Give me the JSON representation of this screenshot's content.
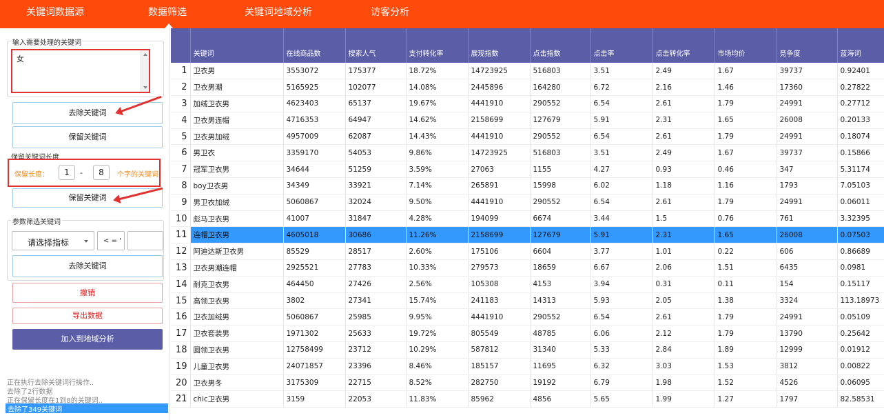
{
  "nav": {
    "tabs": [
      "关键词数据源",
      "数据筛选",
      "关键词地域分析",
      "访客分析"
    ],
    "active_tab": "数据筛选"
  },
  "left": {
    "keyword_section_title": "输入需要处理的关键词",
    "keyword_input_value": "女",
    "remove_keyword_button": "去除关键词",
    "keep_keyword_button": "保留关键词",
    "length_section_title": "保留关键词长度",
    "length_label": "保留长度：",
    "length_min": "1",
    "length_dash": "-",
    "length_max": "8",
    "length_suffix": "个字的关键词",
    "keep_by_length_button": "保留关键词",
    "param_section_title": "参数筛选关键词",
    "metric_select": "请选择指标",
    "operator_select": "< = '",
    "param_value": "",
    "param_remove_button": "去除关键词",
    "undo_button": "撤销",
    "export_button": "导出数据",
    "add_region_button": "加入到地域分析",
    "log": [
      "正在执行去除关键词行操作..",
      "去除了2行数据",
      "正在保留长度在1到8的关键词..",
      "去除了349关键词"
    ]
  },
  "table": {
    "columns": [
      "关键词",
      "在线商品数",
      "搜索人气",
      "支付转化率",
      "展现指数",
      "点击指数",
      "点击率",
      "点击转化率",
      "市场均价",
      "竞争度",
      "蓝海词"
    ],
    "selected_row": 11,
    "rows": [
      {
        "idx": "1",
        "cells": [
          "卫衣男",
          "3553072",
          "175377",
          "18.72%",
          "14723925",
          "516803",
          "3.51",
          "2.49",
          "1.67",
          "39737",
          "0.92401"
        ]
      },
      {
        "idx": "2",
        "cells": [
          "卫衣男潮",
          "5165925",
          "102077",
          "14.08%",
          "2445896",
          "164280",
          "6.72",
          "2.16",
          "1.46",
          "17360",
          "0.27822"
        ]
      },
      {
        "idx": "3",
        "cells": [
          "加绒卫衣男",
          "4623403",
          "65137",
          "19.67%",
          "4441910",
          "290552",
          "6.54",
          "2.61",
          "1.79",
          "24991",
          "0.27712"
        ]
      },
      {
        "idx": "4",
        "cells": [
          "卫衣男连帽",
          "4716353",
          "64947",
          "14.62%",
          "2158699",
          "127679",
          "5.91",
          "2.31",
          "1.65",
          "26008",
          "0.20133"
        ]
      },
      {
        "idx": "5",
        "cells": [
          "卫衣男加绒",
          "4957009",
          "62087",
          "14.43%",
          "4441910",
          "290552",
          "6.54",
          "2.61",
          "1.79",
          "24991",
          "0.18074"
        ]
      },
      {
        "idx": "6",
        "cells": [
          "男卫衣",
          "3359170",
          "54053",
          "9.86%",
          "14723925",
          "516803",
          "3.51",
          "2.49",
          "1.67",
          "39737",
          "0.15866"
        ]
      },
      {
        "idx": "7",
        "cells": [
          "冠军卫衣男",
          "34644",
          "51259",
          "3.59%",
          "27063",
          "1155",
          "4.27",
          "0.93",
          "0.46",
          "347",
          "5.31174"
        ]
      },
      {
        "idx": "8",
        "cells": [
          "boy卫衣男",
          "34349",
          "33921",
          "7.14%",
          "265891",
          "15998",
          "6.02",
          "1.18",
          "1.16",
          "1793",
          "7.05103"
        ]
      },
      {
        "idx": "9",
        "cells": [
          "男卫衣加绒",
          "5060867",
          "32024",
          "9.50%",
          "4441910",
          "290552",
          "6.54",
          "2.61",
          "1.79",
          "24991",
          "0.06011"
        ]
      },
      {
        "idx": "10",
        "cells": [
          "彪马卫衣男",
          "41007",
          "31847",
          "4.28%",
          "194099",
          "6674",
          "3.44",
          "1.5",
          "0.76",
          "761",
          "3.32395"
        ]
      },
      {
        "idx": "11",
        "cells": [
          "连帽卫衣男",
          "4605018",
          "30686",
          "11.26%",
          "2158699",
          "127679",
          "5.91",
          "2.31",
          "1.65",
          "26008",
          "0.07503"
        ]
      },
      {
        "idx": "12",
        "cells": [
          "阿迪达斯卫衣男",
          "85529",
          "28517",
          "2.60%",
          "175106",
          "6604",
          "3.77",
          "1.01",
          "0.22",
          "606",
          "0.86689"
        ]
      },
      {
        "idx": "13",
        "cells": [
          "卫衣男潮连帽",
          "2925521",
          "27783",
          "10.33%",
          "279573",
          "18659",
          "6.67",
          "2.06",
          "1.51",
          "6435",
          "0.0981"
        ]
      },
      {
        "idx": "14",
        "cells": [
          "耐克卫衣男",
          "464450",
          "27426",
          "2.56%",
          "105308",
          "4153",
          "3.94",
          "0.31",
          "0.11",
          "154",
          "0.15117"
        ]
      },
      {
        "idx": "15",
        "cells": [
          "高领卫衣男",
          "3802",
          "27341",
          "15.74%",
          "241183",
          "14313",
          "5.93",
          "2.05",
          "1.38",
          "3324",
          "113.18973"
        ]
      },
      {
        "idx": "16",
        "cells": [
          "卫衣加绒男",
          "5060867",
          "25985",
          "9.95%",
          "4441910",
          "290552",
          "6.54",
          "2.61",
          "1.79",
          "24991",
          "0.05109"
        ]
      },
      {
        "idx": "17",
        "cells": [
          "卫衣套装男",
          "1971302",
          "25633",
          "19.72%",
          "805549",
          "48785",
          "6.06",
          "2.12",
          "1.79",
          "13790",
          "0.25642"
        ]
      },
      {
        "idx": "18",
        "cells": [
          "圆领卫衣男",
          "12758499",
          "23712",
          "10.29%",
          "587812",
          "31340",
          "5.33",
          "2.84",
          "1.89",
          "12999",
          "0.01912"
        ]
      },
      {
        "idx": "19",
        "cells": [
          "儿童卫衣男",
          "24071857",
          "23396",
          "8.46%",
          "185157",
          "11695",
          "6.32",
          "3.03",
          "1.53",
          "3812",
          "0.00822"
        ]
      },
      {
        "idx": "20",
        "cells": [
          "卫衣男冬",
          "3175309",
          "22715",
          "8.52%",
          "282750",
          "19192",
          "6.79",
          "1.98",
          "1.52",
          "4526",
          "0.06095"
        ]
      },
      {
        "idx": "21",
        "cells": [
          "chic卫衣男",
          "3159",
          "22053",
          "11.83%",
          "85962",
          "4856",
          "5.65",
          "1.99",
          "1.27",
          "1797",
          "82.58531"
        ]
      }
    ]
  }
}
